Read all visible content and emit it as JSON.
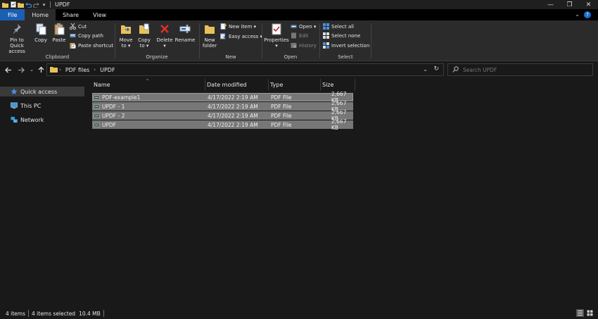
{
  "window": {
    "title": "UPDF",
    "controls": [
      "minimize",
      "maximize",
      "close"
    ]
  },
  "ribbon_tabs": [
    "File",
    "Home",
    "Share",
    "View"
  ],
  "ribbon": {
    "clipboard": {
      "label": "Clipboard",
      "pin": "Pin to Quick\naccess",
      "copy": "Copy",
      "paste": "Paste",
      "cut": "Cut",
      "copy_path": "Copy path",
      "paste_shortcut": "Paste shortcut"
    },
    "organize": {
      "label": "Organize",
      "move_to": "Move\nto ▾",
      "copy_to": "Copy\nto ▾",
      "delete": "Delete\n▾",
      "rename": "Rename"
    },
    "new": {
      "label": "New",
      "new_folder": "New\nfolder",
      "new_item": "New item ▾",
      "easy_access": "Easy access ▾"
    },
    "open": {
      "label": "Open",
      "properties": "Properties\n▾",
      "open": "Open ▾",
      "edit": "Edit",
      "history": "History"
    },
    "select": {
      "label": "Select",
      "select_all": "Select all",
      "select_none": "Select none",
      "invert": "Invert selection"
    }
  },
  "address": {
    "crumbs": [
      "PDF files",
      "UPDF"
    ]
  },
  "search": {
    "placeholder": "Search UPDF"
  },
  "sidebar": {
    "items": [
      {
        "label": "Quick access",
        "icon": "star-icon",
        "selected": true
      },
      {
        "label": "This PC",
        "icon": "pc-icon",
        "selected": false
      },
      {
        "label": "Network",
        "icon": "network-icon",
        "selected": false
      }
    ]
  },
  "columns": [
    "Name",
    "Date modified",
    "Type",
    "Size"
  ],
  "files": [
    {
      "name": "PDF-example1",
      "date": "4/17/2022 2:19 AM",
      "type": "PDF File",
      "size": "2,667 KB"
    },
    {
      "name": "UPDF - 1",
      "date": "4/17/2022 2:19 AM",
      "type": "PDF File",
      "size": "2,667 KB"
    },
    {
      "name": "UPDF - 2",
      "date": "4/17/2022 2:19 AM",
      "type": "PDF File",
      "size": "2,667 KB"
    },
    {
      "name": "UPDF",
      "date": "4/17/2022 2:19 AM",
      "type": "PDF File",
      "size": "2,667 KB"
    }
  ],
  "status": {
    "count": "4 items",
    "selected": "4 items selected",
    "size": "10.4 MB"
  },
  "colors": {
    "accent": "#1a5fb4",
    "selection": "#777777",
    "background": "#191919"
  }
}
